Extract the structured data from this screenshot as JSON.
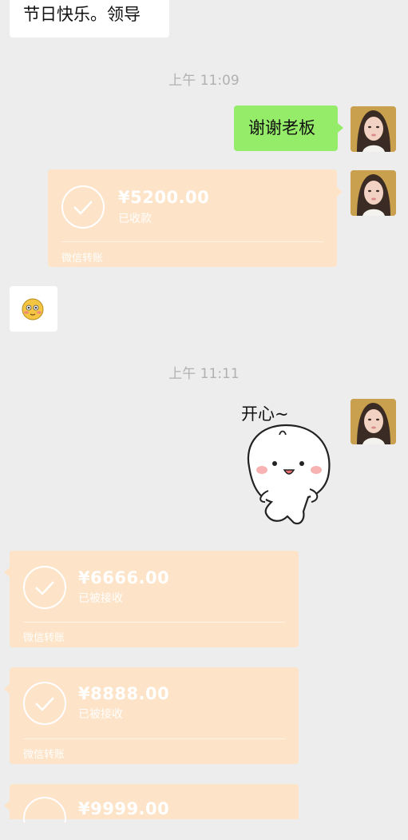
{
  "messages": {
    "top_left_text": "节日快乐。领导",
    "time_1": "上午 11:09",
    "reply_text": "谢谢老板",
    "transfer_1": {
      "amount": "¥5200.00",
      "status": "已收款",
      "label": "微信转账"
    },
    "time_2": "上午 11:11",
    "sticker_text": "开心~",
    "transfer_2": {
      "amount": "¥6666.00",
      "status": "已被接收",
      "label": "微信转账"
    },
    "transfer_3": {
      "amount": "¥8888.00",
      "status": "已被接收",
      "label": "微信转账"
    },
    "transfer_4": {
      "amount": "¥9999.00"
    }
  },
  "colors": {
    "background": "#ededed",
    "green_bubble": "#95ec69",
    "transfer_bg": "#fde4c8",
    "timestamp": "#b1b1b1"
  },
  "icons": {
    "emoji": "blushing-face-emoji",
    "transfer": "check-circle-icon",
    "sticker": "happy-cartoon-sticker"
  }
}
